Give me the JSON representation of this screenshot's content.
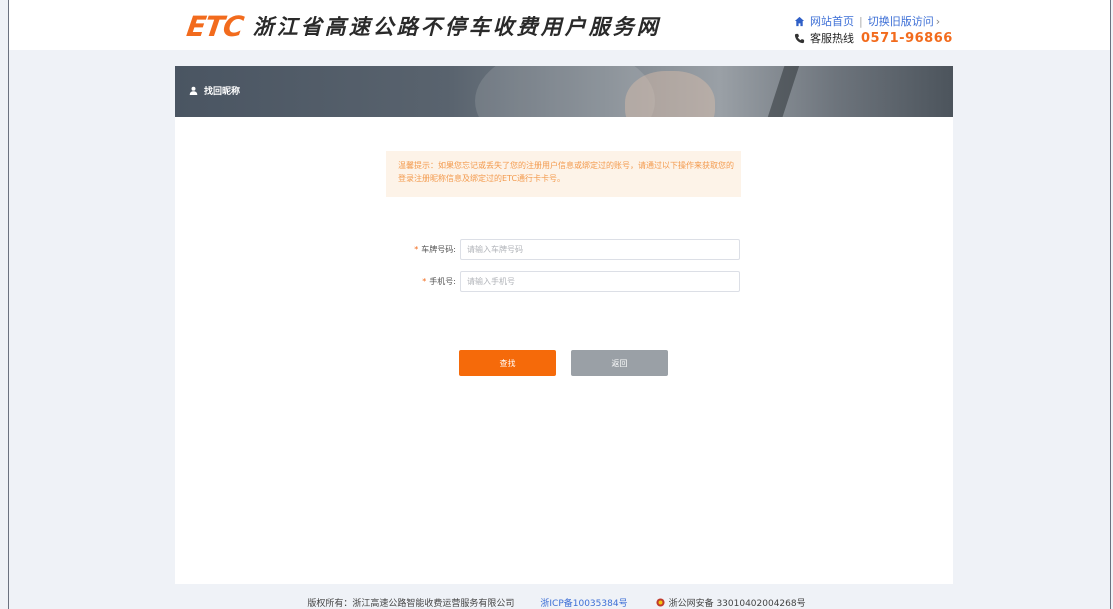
{
  "header": {
    "logo": "ETC",
    "title": "浙江省高速公路不停车收费用户服务网",
    "home_link": "网站首页",
    "old_version_link": "切换旧版访问",
    "hotline_label": "客服热线",
    "hotline_number": "0571-96866"
  },
  "banner": {
    "title": "找回昵称"
  },
  "notice": {
    "text": "温馨提示：如果您忘记或丢失了您的注册用户信息或绑定过的账号，请通过以下操作来获取您的登录注册昵称信息及绑定过的ETC通行卡卡号。"
  },
  "form": {
    "plate": {
      "label": "车牌号码:",
      "placeholder": "请输入车牌号码",
      "value": ""
    },
    "phone": {
      "label": "手机号:",
      "placeholder": "请输入手机号",
      "value": ""
    },
    "search_label": "查找",
    "back_label": "返回"
  },
  "footer": {
    "copyright": "版权所有：浙江高速公路智能收费运营服务有限公司",
    "icp": "浙ICP备10035384号",
    "police": "浙公网安备 33010402004268号"
  },
  "colors": {
    "brand_orange": "#f26b1d",
    "link_blue": "#3d6fd6",
    "search_button": "#f56a0a",
    "back_button": "#9aa0a6"
  }
}
